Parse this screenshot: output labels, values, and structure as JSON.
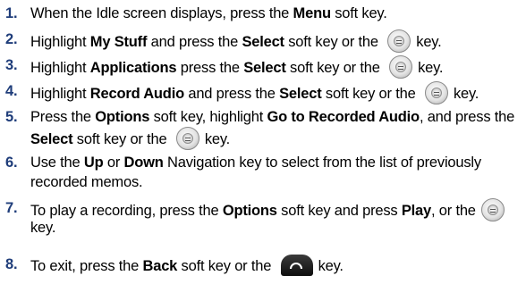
{
  "steps": [
    {
      "num": "1.",
      "parts": [
        "When the Idle screen displays, press the ",
        "Menu",
        " soft key."
      ]
    },
    {
      "num": "2.",
      "parts": [
        "Highlight ",
        "My Stuff",
        " and press the ",
        "Select",
        " soft key or the ",
        "key."
      ],
      "icon": "ok-key-icon"
    },
    {
      "num": "3.",
      "parts": [
        "Highlight ",
        "Applications",
        " press the ",
        "Select",
        " soft key or the ",
        "key."
      ],
      "icon": "ok-key-icon"
    },
    {
      "num": "4.",
      "parts": [
        "Highlight ",
        "Record Audio",
        " and press the ",
        "Select",
        " soft key or the ",
        "key."
      ],
      "icon": "ok-key-icon"
    },
    {
      "num": "5.",
      "parts": [
        "Press the ",
        "Options",
        " soft key, highlight ",
        "Go to Recorded Audio",
        ", and press the"
      ],
      "line2": [
        "Select",
        " soft key or the ",
        "key."
      ],
      "icon": "ok-key-icon"
    },
    {
      "num": "6.",
      "parts": [
        "Use the ",
        "Up",
        " or ",
        "Down",
        " Navigation key to select from the list of previously"
      ],
      "line2": [
        "recorded memos."
      ]
    },
    {
      "num": "7.",
      "parts": [
        "To play a recording, press the ",
        "Options",
        " soft key and press ",
        "Play",
        ", or the"
      ],
      "line2": [
        "key."
      ],
      "icon": "ok-key-icon"
    },
    {
      "num": "8.",
      "parts": [
        "To exit, press the ",
        "Back",
        " soft key or the ",
        "key."
      ],
      "icon": "end-key-icon"
    }
  ]
}
